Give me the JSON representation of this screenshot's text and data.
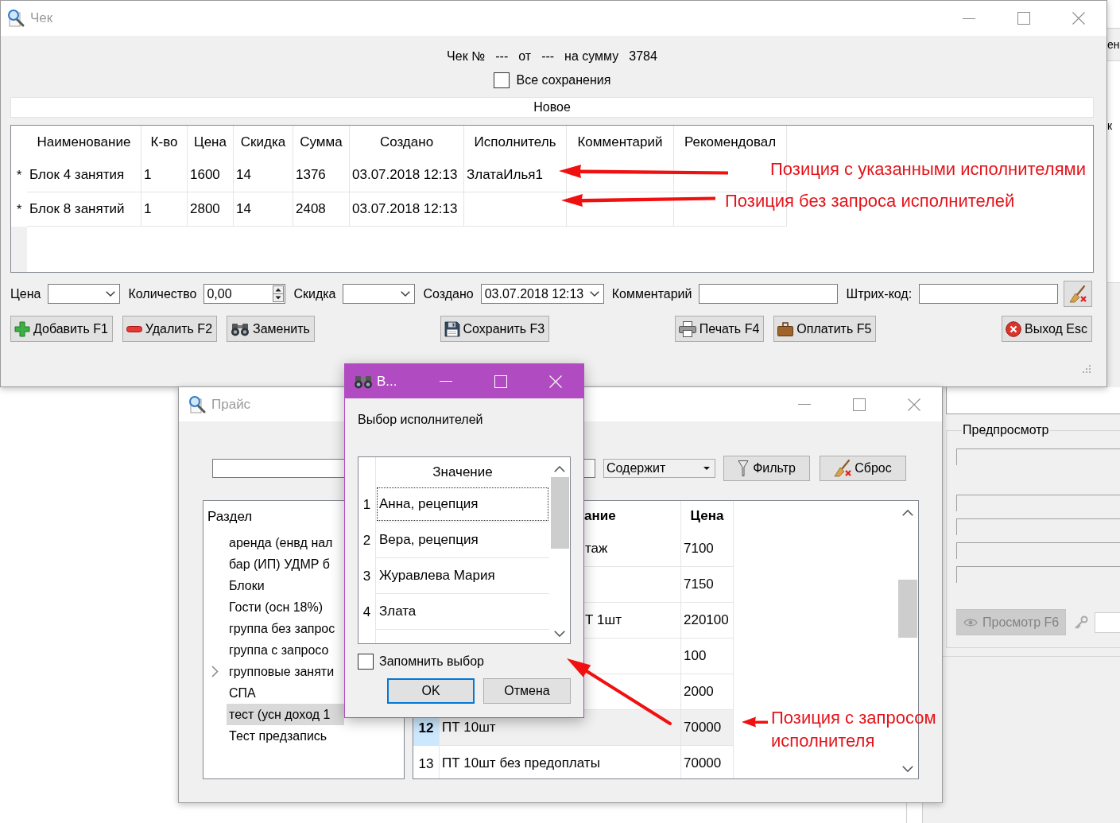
{
  "background_texts": [
    "ен",
    "к"
  ],
  "preview_panel": {
    "title": "Предпросмотр",
    "view_button": {
      "label": "Просмотр F6",
      "disabled": true
    }
  },
  "receipt_window": {
    "title": "Чек",
    "summary": {
      "number_label": "Чек №",
      "number": "---",
      "date_label": "от",
      "date": "---",
      "sum_label": "на сумму",
      "sum": "3784"
    },
    "all_saves": {
      "label": "Все сохранения",
      "checked": false
    },
    "status": "Новое",
    "table": {
      "columns": [
        "Наименование",
        "К-во",
        "Цена",
        "Скидка",
        "Сумма",
        "Создано",
        "Исполнитель",
        "Комментарий",
        "Рекомендовал"
      ],
      "rows": [
        {
          "marker": "*",
          "cells": [
            "Блок 4 занятия",
            "1",
            "1600",
            "14",
            "1376",
            "03.07.2018 12:13",
            "ЗлатаИлья1"
          ]
        },
        {
          "marker": "*",
          "cells": [
            "Блок 8 занятий",
            "1",
            "2800",
            "14",
            "2408",
            "03.07.2018 12:13"
          ]
        }
      ]
    },
    "fields": [
      {
        "kind": "dropdown",
        "label": "Цена"
      },
      {
        "kind": "spin",
        "label": "Количество",
        "value": "0,00"
      },
      {
        "kind": "dropdown",
        "label": "Скидка"
      },
      {
        "kind": "dropdown",
        "label": "Создано",
        "value": "03.07.2018 12:13"
      },
      {
        "kind": "text",
        "label": "Комментарий"
      },
      {
        "kind": "text",
        "label": "Штрих-код:"
      }
    ],
    "button_groups": [
      [
        {
          "label": "Добавить F1"
        },
        {
          "label": "Удалить F2"
        },
        {
          "label": "Заменить"
        }
      ],
      [
        {
          "label": "Сохранить F3"
        }
      ],
      [
        {
          "label": "Печать F4"
        },
        {
          "label": "Оплатить F5"
        }
      ],
      [
        {
          "label": "Выход Esc"
        }
      ]
    ]
  },
  "price_window": {
    "title": "Прайс",
    "match_mode": "Содержит",
    "buttons": [
      {
        "label": "Фильтр"
      },
      {
        "label": "Сброс"
      }
    ],
    "sections": {
      "header": "Раздел",
      "items": [
        {
          "label": "аренда (енвд нал",
          "has_children": false,
          "expanded": false,
          "selected": false
        },
        {
          "label": "бар (ИП) УДМР б",
          "has_children": false,
          "expanded": false,
          "selected": false
        },
        {
          "label": "Блоки",
          "has_children": false,
          "expanded": false,
          "selected": false
        },
        {
          "label": "Гости (осн 18%)",
          "has_children": false,
          "expanded": false,
          "selected": false
        },
        {
          "label": "группа без запрос",
          "has_children": false,
          "expanded": false,
          "selected": false
        },
        {
          "label": "группа с запросо",
          "has_children": false,
          "expanded": false,
          "selected": false
        },
        {
          "label": "групповые заняти",
          "has_children": true,
          "expanded": false,
          "selected": false
        },
        {
          "label": "СПА",
          "has_children": false,
          "expanded": false,
          "selected": false
        },
        {
          "label": "тест (усн доход 1",
          "has_children": false,
          "expanded": false,
          "selected": true
        },
        {
          "label": "Тест предзапись",
          "has_children": false,
          "expanded": false,
          "selected": false
        }
      ]
    },
    "table": {
      "columns": [
        "ание",
        "Цена"
      ],
      "rows": [
        {
          "name": "таж",
          "price": "7100",
          "selected": false
        },
        {
          "price": "7150",
          "selected": false
        },
        {
          "name": "Т 1шт",
          "price": "220100",
          "selected": false
        },
        {
          "price": "100",
          "selected": false
        },
        {
          "price": "2000",
          "selected": false
        },
        {
          "number": "12",
          "name": "ПТ 10шт",
          "price": "70000",
          "selected": true
        },
        {
          "number": "13",
          "name": "ПТ 10шт без предоплаты",
          "price": "70000",
          "selected": false
        }
      ]
    }
  },
  "performer_dialog": {
    "title": "В...",
    "heading": "Выбор исполнителей",
    "list": {
      "column": "Значение",
      "rows": [
        {
          "number": "1",
          "value": "Анна, рецепция",
          "selected": true
        },
        {
          "number": "2",
          "value": "Вера, рецепция",
          "selected": false
        },
        {
          "number": "3",
          "value": "Журавлева Мария",
          "selected": false
        },
        {
          "number": "4",
          "value": "Злата",
          "selected": false
        }
      ]
    },
    "remember": {
      "label": "Запомнить выбор",
      "checked": false
    },
    "buttons": [
      {
        "label": "OK",
        "default": true
      },
      {
        "label": "Отмена",
        "default": false
      }
    ]
  },
  "annotations": [
    {
      "text": "Позиция с указанными исполнителями"
    },
    {
      "text": "Позиция без запроса исполнителей"
    },
    {
      "text": "Позиция с запросом исполнителя"
    }
  ]
}
